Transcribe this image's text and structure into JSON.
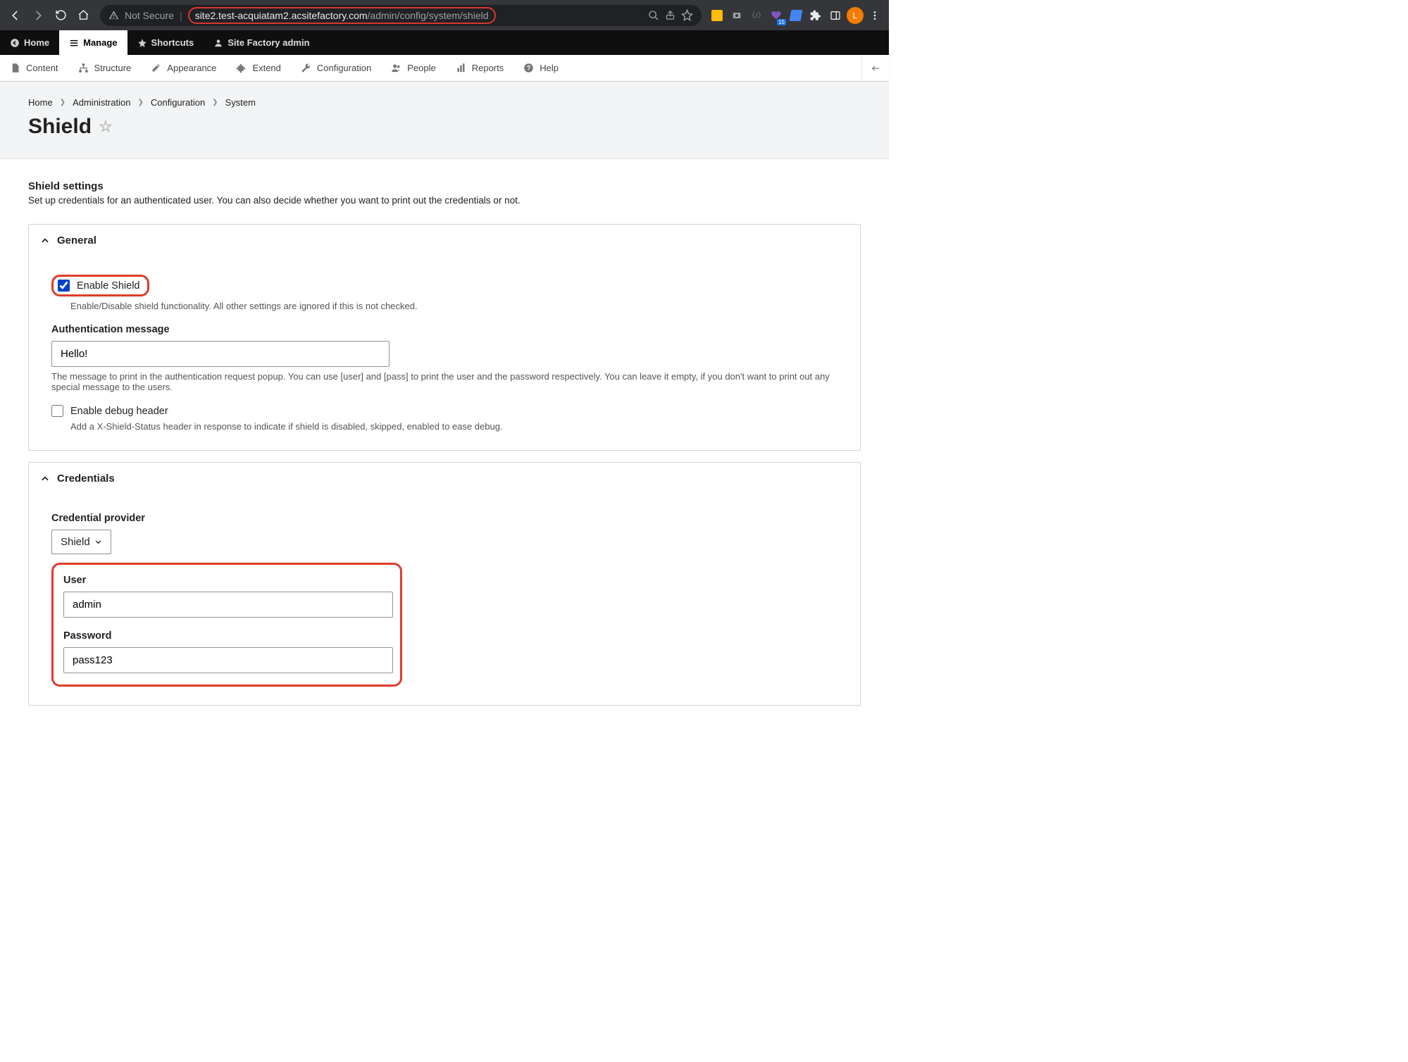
{
  "browser": {
    "not_secure": "Not Secure",
    "url_main": "site2.test-acquiatam2.acsitefactory.com",
    "url_path": "/admin/config/system/shield",
    "avatar_initial": "L",
    "badge": "15"
  },
  "toolbar": {
    "home": "Home",
    "manage": "Manage",
    "shortcuts": "Shortcuts",
    "user": "Site Factory admin"
  },
  "admin_tabs": {
    "content": "Content",
    "structure": "Structure",
    "appearance": "Appearance",
    "extend": "Extend",
    "configuration": "Configuration",
    "people": "People",
    "reports": "Reports",
    "help": "Help"
  },
  "breadcrumbs": [
    "Home",
    "Administration",
    "Configuration",
    "System"
  ],
  "page_title": "Shield",
  "settings": {
    "heading": "Shield settings",
    "description": "Set up credentials for an authenticated user. You can also decide whether you want to print out the credentials or not."
  },
  "general": {
    "title": "General",
    "enable_label": "Enable Shield",
    "enable_help": "Enable/Disable shield functionality. All other settings are ignored if this is not checked.",
    "auth_msg_label": "Authentication message",
    "auth_msg_value": "Hello!",
    "auth_msg_help": "The message to print in the authentication request popup. You can use [user] and [pass] to print the user and the password respectively. You can leave it empty, if you don't want to print out any special message to the users.",
    "debug_label": "Enable debug header",
    "debug_help": "Add a X-Shield-Status header in response to indicate if shield is disabled, skipped, enabled to ease debug."
  },
  "credentials": {
    "title": "Credentials",
    "provider_label": "Credential provider",
    "provider_value": "Shield",
    "user_label": "User",
    "user_value": "admin",
    "pass_label": "Password",
    "pass_value": "pass123"
  }
}
